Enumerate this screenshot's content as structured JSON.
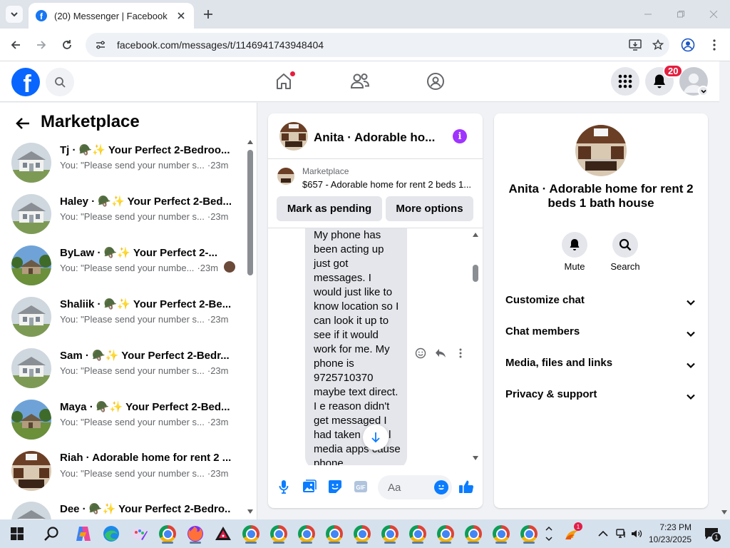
{
  "browser": {
    "tab_title": "(20) Messenger | Facebook",
    "url": "facebook.com/messages/t/1146941743948404"
  },
  "fb_header": {
    "notification_count": "20"
  },
  "left_panel": {
    "title": "Marketplace",
    "conversations": [
      {
        "name": "Tj · 🪖✨ Your Perfect 2-Bedroo...",
        "snippet": "You: \"Please send your number s...",
        "time": "·23m"
      },
      {
        "name": "Haley · 🪖✨ Your Perfect 2-Bed...",
        "snippet": "You: \"Please send your number s...",
        "time": "·23m"
      },
      {
        "name": "ByLaw · 🪖✨ Your Perfect 2-...",
        "snippet": "You: \"Please send your numbe...",
        "time": "·23m"
      },
      {
        "name": "Shaliik · 🪖✨ Your Perfect 2-Be...",
        "snippet": "You: \"Please send your number s...",
        "time": "·23m"
      },
      {
        "name": "Sam · 🪖✨ Your Perfect 2-Bedr...",
        "snippet": "You: \"Please send your number s...",
        "time": "·23m"
      },
      {
        "name": "Maya · 🪖✨ Your Perfect 2-Bed...",
        "snippet": "You: \"Please send your number s...",
        "time": "·23m"
      },
      {
        "name": "Riah · Adorable home for rent 2 ...",
        "snippet": "You: \"Please send your number s...",
        "time": "·23m"
      },
      {
        "name": "Dee · 🪖✨ Your Perfect 2-Bedro...",
        "snippet": "",
        "time": ""
      }
    ]
  },
  "chat": {
    "name": "Anita · Adorable ho...",
    "marketplace_label": "Marketplace",
    "listing": "$657 - Adorable home for rent 2 beds 1...",
    "mark_pending": "Mark as pending",
    "more_options": "More options",
    "message": "My phone has been acting up just got messages. I would just like to know location so I can look it up to see if it would work for me. My phone is 9725710370 maybe text direct. I e reason didn't get messaged I had taken social media apps cause phone",
    "composer_placeholder": "Aa"
  },
  "right_panel": {
    "name": "Anita · Adorable home for rent 2 beds 1 bath house",
    "mute": "Mute",
    "search": "Search",
    "sections": [
      "Customize chat",
      "Chat members",
      "Media, files and links",
      "Privacy & support"
    ]
  },
  "taskbar": {
    "time": "7:23 PM",
    "date": "10/23/2025",
    "notif_count": "1",
    "app_badge": "1"
  },
  "colors": {
    "facebook_blue": "#0866ff",
    "messenger_accent": "#0a7cff",
    "info_purple": "#a033ff",
    "badge_red": "#e41e3f"
  }
}
